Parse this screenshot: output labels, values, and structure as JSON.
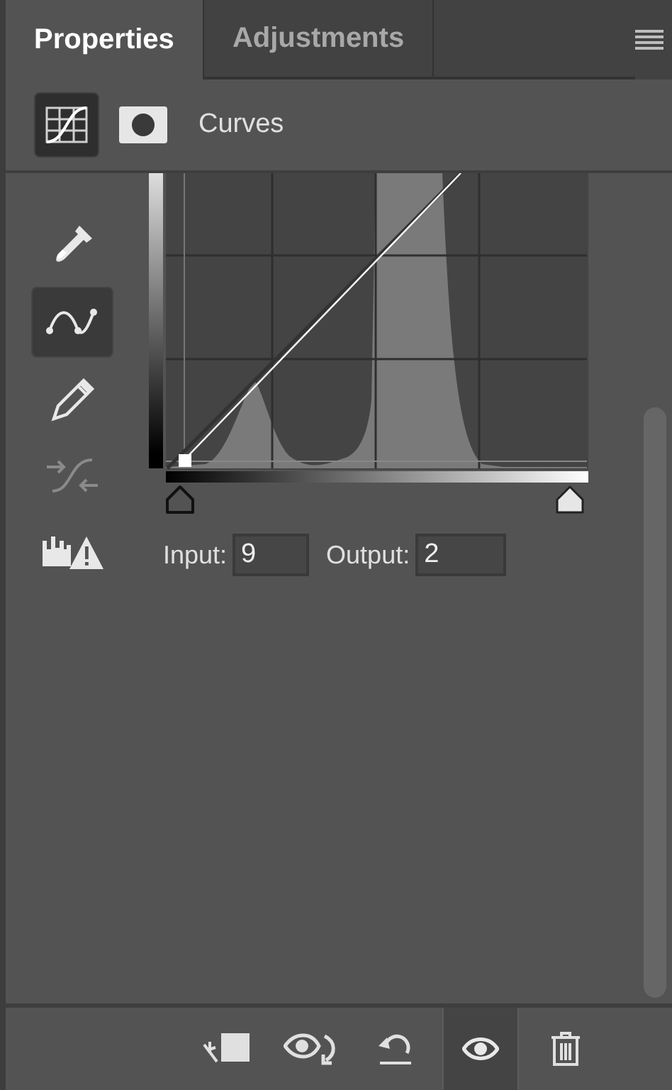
{
  "tabs": [
    {
      "label": "Properties",
      "selected": true
    },
    {
      "label": "Adjustments",
      "selected": false
    }
  ],
  "header": {
    "title": "Curves",
    "modes": [
      {
        "kind": "curves",
        "selected": true
      },
      {
        "kind": "mask",
        "selected": false
      }
    ]
  },
  "tools": [
    {
      "kind": "eyedropper",
      "selected": false,
      "disabled": false
    },
    {
      "kind": "point-curve",
      "selected": true,
      "disabled": false
    },
    {
      "kind": "pencil",
      "selected": false,
      "disabled": false
    },
    {
      "kind": "smooth",
      "selected": false,
      "disabled": true
    },
    {
      "kind": "clipping",
      "selected": false,
      "disabled": false
    }
  ],
  "fields": [
    {
      "label": "Input:",
      "value": "9"
    },
    {
      "label": "Output:",
      "value": "2"
    }
  ],
  "footer_buttons": [
    {
      "kind": "clip",
      "selected": false
    },
    {
      "kind": "view-previous",
      "selected": false
    },
    {
      "kind": "reset",
      "selected": false
    },
    {
      "kind": "visibility",
      "selected": true
    },
    {
      "kind": "delete",
      "selected": false
    }
  ]
}
